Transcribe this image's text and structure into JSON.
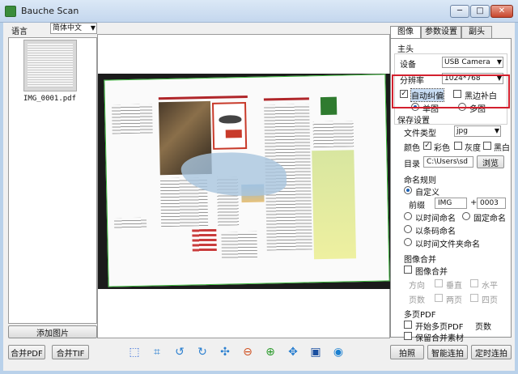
{
  "window": {
    "title": "Bauche Scan",
    "min": "─",
    "max": "□",
    "close": "✕"
  },
  "left": {
    "lang_label": "语言",
    "lang_value": "简体中文",
    "thumb_name": "IMG_0001.pdf",
    "add_button": "添加图片"
  },
  "toolbar": {
    "merge_pdf": "合并PDF",
    "merge_tif": "合并TIF",
    "icons": [
      "select-icon",
      "crop-icon",
      "rotate-left-icon",
      "rotate-right-icon",
      "move-icon",
      "zoom-out-icon",
      "zoom-in-icon",
      "fit-icon",
      "film-icon",
      "eye-icon"
    ],
    "shoot": "拍照",
    "smart_shoot": "智能连拍",
    "timed_shoot": "定时连拍"
  },
  "tabs": [
    "图像",
    "参数设置",
    "副头"
  ],
  "main_head": {
    "title": "主头",
    "device_label": "设备",
    "device_value": "USB Camera",
    "res_label": "分辨率",
    "res_value": "1024*768",
    "auto_crop": "自动纠偏",
    "black_fill": "黑边补白",
    "single": "单图",
    "multi": "多图"
  },
  "save": {
    "title": "保存设置",
    "type_label": "文件类型",
    "type_value": "jpg",
    "color_label": "颜色",
    "color_opt": "彩色",
    "gray_opt": "灰度",
    "bw_opt": "黑白",
    "dir_label": "目录",
    "dir_value": "C:\\Users\\sd",
    "browse": "浏览"
  },
  "naming": {
    "title": "命名规则",
    "custom": "自定义",
    "prefix_label": "前缀",
    "prefix_value": "IMG",
    "plus": "+",
    "counter": "0003",
    "by_time": "以时间命名",
    "fixed": "固定命名",
    "by_barcode": "以条码命名",
    "by_time_folder": "以时间文件夹命名"
  },
  "merge": {
    "title": "图像合并",
    "enable": "图像合并",
    "direction": "方向",
    "vertical": "垂直",
    "horizontal": "水平",
    "pages": "页数",
    "two": "两页",
    "four": "四页"
  },
  "multipdf": {
    "title": "多页PDF",
    "start": "开始多页PDF",
    "pages_label": "页数",
    "keep": "保留合并素材"
  },
  "colors": {
    "highlight": "#d3202e",
    "edge_green": "#3cb83c"
  }
}
